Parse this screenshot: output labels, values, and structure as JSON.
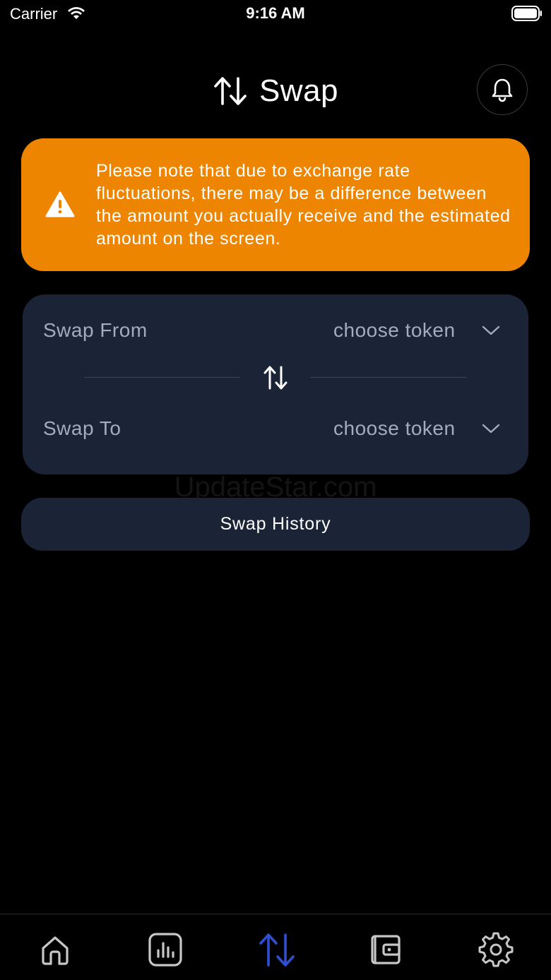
{
  "status_bar": {
    "carrier": "Carrier",
    "time": "9:16 AM"
  },
  "header": {
    "title": "Swap",
    "title_icon": "swap-arrows-icon",
    "notification_icon": "bell-icon"
  },
  "warning": {
    "icon": "warning-icon",
    "text": "Please note that due to exchange rate fluctuations, there may be a difference between  the amount you actually receive and the estimated amount on the screen.",
    "background_color": "#ee8500"
  },
  "swap_card": {
    "from_label": "Swap From",
    "from_token": "choose token",
    "to_label": "Swap To",
    "to_token": "choose token",
    "switch_icon": "swap-arrows-icon"
  },
  "watermark": "UpdateStar.com",
  "history_button": {
    "label": "Swap History"
  },
  "tab_bar": {
    "items": [
      {
        "icon": "home-icon",
        "active": false
      },
      {
        "icon": "chart-icon",
        "active": false
      },
      {
        "icon": "swap-arrows-icon",
        "active": true
      },
      {
        "icon": "wallet-icon",
        "active": false
      },
      {
        "icon": "gear-icon",
        "active": false
      }
    ],
    "active_color": "#2f4fd1",
    "inactive_color": "#c7c7c7"
  }
}
